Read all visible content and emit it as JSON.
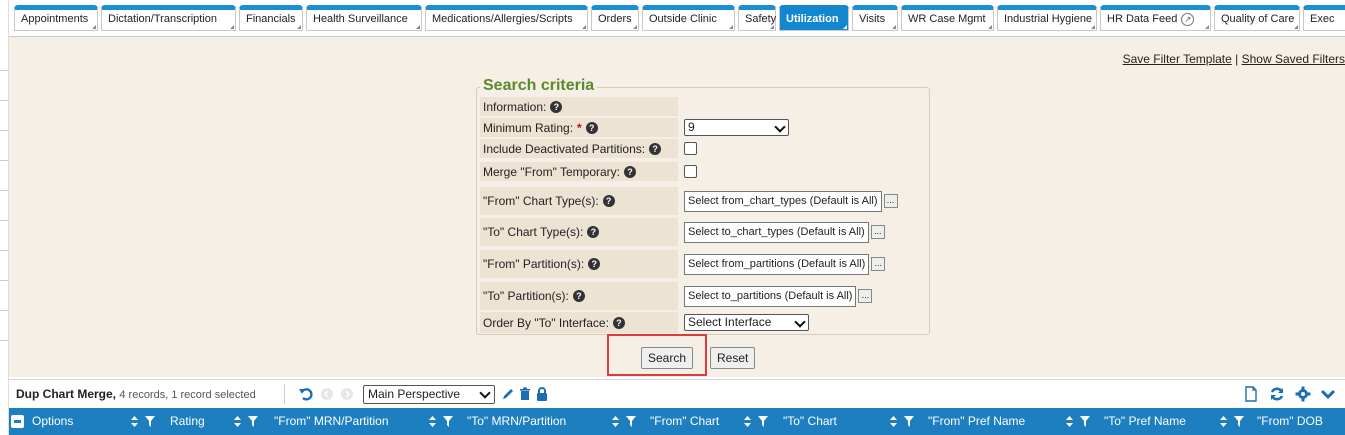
{
  "tabs": [
    {
      "label": "Appointments",
      "active": false
    },
    {
      "label": "Dictation/Transcription",
      "active": false
    },
    {
      "label": "Financials",
      "active": false
    },
    {
      "label": "Health Surveillance",
      "active": false
    },
    {
      "label": "Medications/Allergies/Scripts",
      "active": false
    },
    {
      "label": "Orders",
      "active": false
    },
    {
      "label": "Outside Clinic",
      "active": false
    },
    {
      "label": "Safety",
      "active": false
    },
    {
      "label": "Utilization",
      "active": true
    },
    {
      "label": "Visits",
      "active": false
    },
    {
      "label": "WR Case Mgmt",
      "active": false
    },
    {
      "label": "Industrial Hygiene",
      "active": false
    },
    {
      "label": "HR Data Feed",
      "active": false
    },
    {
      "label": "Quality of Care",
      "active": false
    },
    {
      "label": "Exec",
      "active": false
    }
  ],
  "links": {
    "save_filter": "Save Filter Template",
    "separator": "|",
    "show_saved": "Show Saved Filters"
  },
  "search": {
    "legend": "Search criteria",
    "information_label": "Information:",
    "minimum_rating_label": "Minimum Rating:",
    "minimum_rating_value": "9",
    "include_deactivated_label": "Include Deactivated Partitions:",
    "merge_from_temporary_label": "Merge \"From\" Temporary:",
    "from_chart_types_label": "\"From\" Chart Type(s):",
    "from_chart_types_value": "Select from_chart_types (Default is All)",
    "to_chart_types_label": "\"To\" Chart Type(s):",
    "to_chart_types_value": "Select to_chart_types (Default is All)",
    "from_partitions_label": "\"From\" Partition(s):",
    "from_partitions_value": "Select from_partitions (Default is All)",
    "to_partitions_label": "\"To\" Partition(s):",
    "to_partitions_value": "Select to_partitions (Default is All)",
    "order_by_label": "Order By \"To\" Interface:",
    "order_by_value": "Select Interface",
    "search_button": "Search",
    "reset_button": "Reset",
    "ellipsis": "..."
  },
  "grid": {
    "title": "Dup Chart Merge,",
    "subtitle": "4 records, 1 record selected",
    "perspective": "Main Perspective",
    "columns": [
      "Options",
      "Rating",
      "\"From\" MRN/Partition",
      "\"To\" MRN/Partition",
      "\"From\" Chart",
      "\"To\" Chart",
      "\"From\" Pref Name",
      "\"To\" Pref Name",
      "\"From\" DOB"
    ]
  },
  "colors": {
    "tab_accent": "#1b8fd3",
    "active_tab": "#1287cf",
    "legend_green": "#5b8a2a",
    "column_header": "#1d7fc0",
    "highlight_red": "#e0393e",
    "content_bg": "#f6efe5"
  }
}
